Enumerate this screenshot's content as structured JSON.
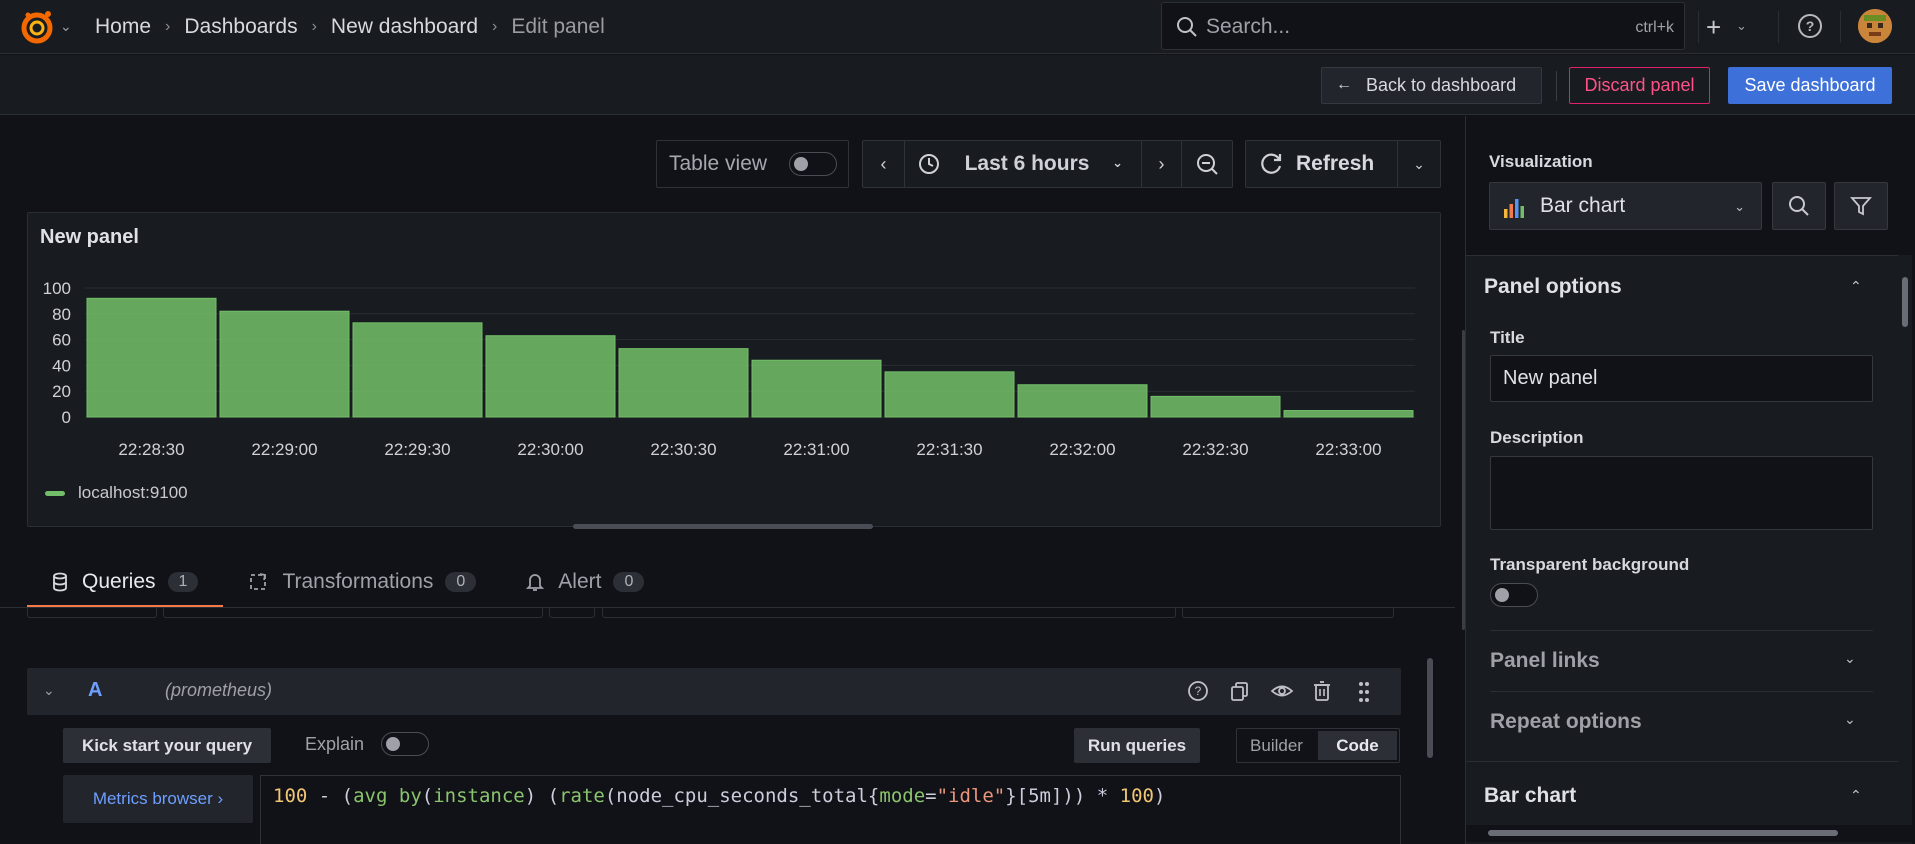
{
  "topbar": {
    "breadcrumbs": [
      "Home",
      "Dashboards",
      "New dashboard",
      "Edit panel"
    ],
    "search_placeholder": "Search...",
    "search_shortcut": "ctrl+k"
  },
  "actions": {
    "back": "Back to dashboard",
    "discard": "Discard panel",
    "save": "Save dashboard"
  },
  "toolbar": {
    "table_view": "Table view",
    "table_view_on": false,
    "time_range": "Last 6 hours",
    "refresh": "Refresh"
  },
  "panel": {
    "title": "New panel",
    "legend": "localhost:9100"
  },
  "chart_data": {
    "type": "bar",
    "categories": [
      "22:28:30",
      "22:29:00",
      "22:29:30",
      "22:30:00",
      "22:30:30",
      "22:31:00",
      "22:31:30",
      "22:32:00",
      "22:32:30",
      "22:33:00"
    ],
    "series": [
      {
        "name": "localhost:9100",
        "values": [
          92,
          82,
          73,
          63,
          53,
          44,
          35,
          25,
          16,
          5
        ]
      }
    ],
    "yticks": [
      0,
      20,
      40,
      60,
      80,
      100
    ],
    "ylim": [
      0,
      100
    ],
    "color": "#73bf69",
    "grid": true,
    "legend_position": "bottom-left"
  },
  "tabs": [
    {
      "label": "Queries",
      "count": "1",
      "active": true
    },
    {
      "label": "Transformations",
      "count": "0",
      "active": false
    },
    {
      "label": "Alert",
      "count": "0",
      "active": false
    }
  ],
  "query": {
    "id": "A",
    "datasource": "(prometheus)",
    "kick_start": "Kick start your query",
    "explain": "Explain",
    "run": "Run queries",
    "mode_builder": "Builder",
    "mode_code": "Code",
    "metrics_browser": "Metrics browser ›",
    "expr": {
      "p1": "100",
      "p2": " - (",
      "p3": "avg",
      "p4": " ",
      "p5": "by",
      "p6": "(",
      "p7": "instance",
      "p8": ") (",
      "p9": "rate",
      "p10": "(node_cpu_seconds_total{",
      "p11": "mode",
      "p12": "=",
      "p13": "\"idle\"",
      "p14": "}[5m])) * ",
      "p15": "100",
      "p16": ")"
    }
  },
  "options": {
    "visualization_label": "Visualization",
    "visualization": "Bar chart",
    "panel_options": "Panel options",
    "title_label": "Title",
    "title_value": "New panel",
    "description_label": "Description",
    "transparent_label": "Transparent background",
    "panel_links": "Panel links",
    "repeat_options": "Repeat options",
    "bar_chart": "Bar chart"
  }
}
